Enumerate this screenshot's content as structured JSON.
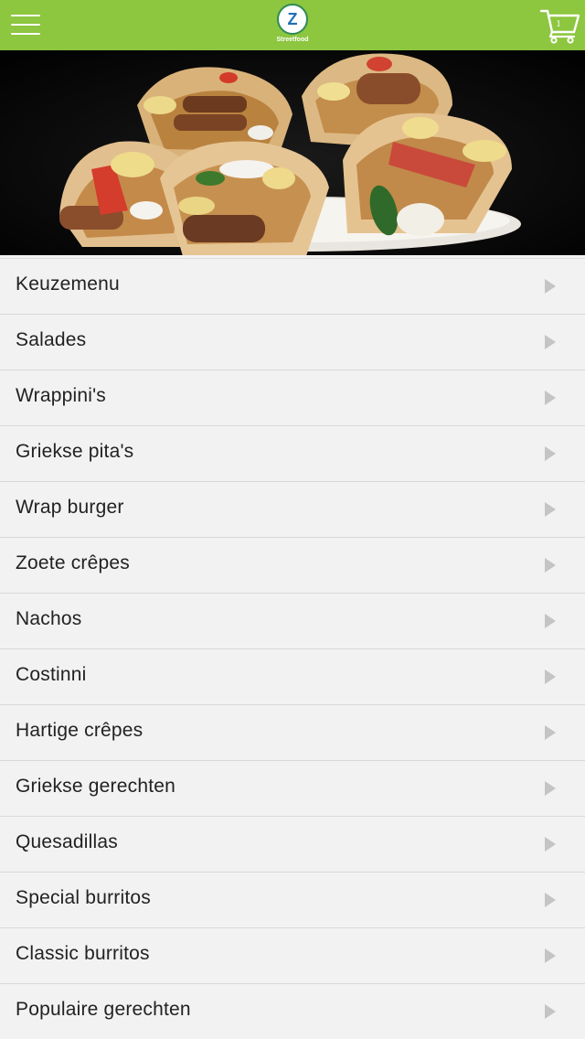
{
  "header": {
    "logo_letter": "Z",
    "logo_text": "Streetfood",
    "cart_count": "1",
    "bar_color": "#8dc63f",
    "icons": [
      "hamburger-menu-icon",
      "cart-icon"
    ]
  },
  "hero": {
    "image": "food-photo-pitas"
  },
  "menu": {
    "items": [
      {
        "label": "Keuzemenu"
      },
      {
        "label": "Salades"
      },
      {
        "label": "Wrappini's"
      },
      {
        "label": "Griekse pita's"
      },
      {
        "label": "Wrap burger"
      },
      {
        "label": "Zoete crêpes"
      },
      {
        "label": "Nachos"
      },
      {
        "label": "Costinni"
      },
      {
        "label": "Hartige crêpes"
      },
      {
        "label": "Griekse gerechten"
      },
      {
        "label": "Quesadillas"
      },
      {
        "label": "Special burritos"
      },
      {
        "label": "Classic burritos"
      },
      {
        "label": "Populaire gerechten"
      }
    ]
  }
}
